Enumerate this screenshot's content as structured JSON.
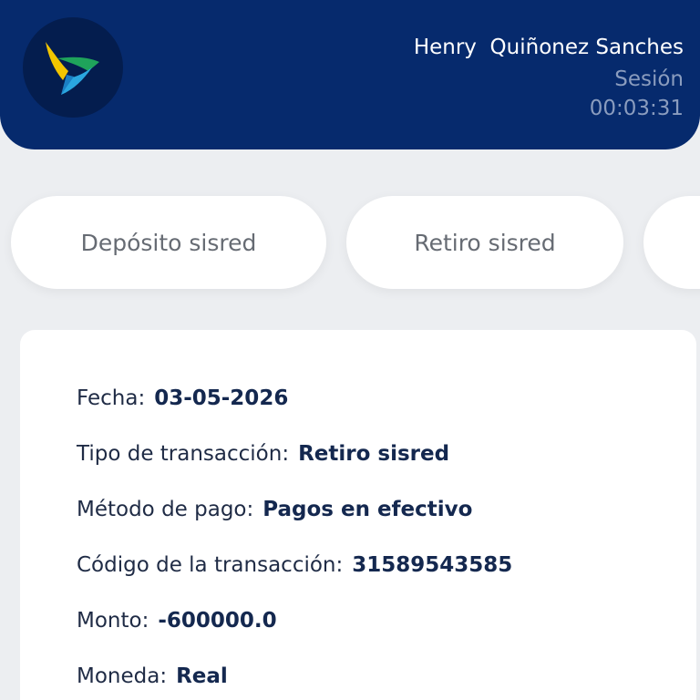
{
  "header": {
    "user_name": "Henry  Quiñonez Sanches",
    "session_label": "Sesión",
    "session_time": "00:03:31"
  },
  "tabs": [
    {
      "label": "Depósito sisred"
    },
    {
      "label": "Retiro sisred"
    },
    {
      "label": ""
    }
  ],
  "details": [
    {
      "label": "Fecha:",
      "value": "03-05-2026"
    },
    {
      "label": "Tipo de transacción:",
      "value": "Retiro sisred"
    },
    {
      "label": "Método de pago:",
      "value": "Pagos en efectivo"
    },
    {
      "label": "Código de la transacción:",
      "value": "31589543585"
    },
    {
      "label": "Monto:",
      "value": "-600000.0"
    },
    {
      "label": "Moneda:",
      "value": "Real"
    }
  ],
  "colors": {
    "header_bg": "#062a6d",
    "logo_yellow": "#f2c500",
    "logo_green": "#1fa35b",
    "logo_blue": "#2aa6e0"
  }
}
